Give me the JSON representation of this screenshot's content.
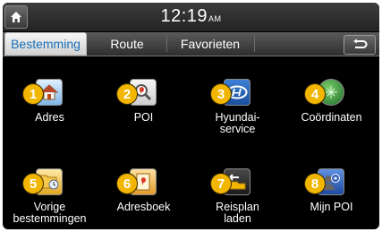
{
  "status_bar": {
    "time": "12:19",
    "ampm": "AM"
  },
  "tabs": [
    {
      "label": "Bestemming",
      "selected": true
    },
    {
      "label": "Route",
      "selected": false
    },
    {
      "label": "Favorieten",
      "selected": false
    }
  ],
  "icons": {
    "home": "home-icon",
    "back": "back-arrow-icon"
  },
  "menu": [
    {
      "number": "1",
      "label": "Adres",
      "icon": "house-icon"
    },
    {
      "number": "2",
      "label": "POI",
      "icon": "poi-search-icon"
    },
    {
      "number": "3",
      "label": "Hyundai-\nservice",
      "icon": "hyundai-logo-icon"
    },
    {
      "number": "4",
      "label": "Coördinaten",
      "icon": "globe-icon"
    },
    {
      "number": "5",
      "label": "Vorige\nbestemmingen",
      "icon": "folder-clock-icon"
    },
    {
      "number": "6",
      "label": "Adresboek",
      "icon": "address-book-icon"
    },
    {
      "number": "7",
      "label": "Reisplan\nladen",
      "icon": "route-plan-icon"
    },
    {
      "number": "8",
      "label": "Mijn POI",
      "icon": "my-poi-icon"
    }
  ],
  "colors": {
    "badge": "#f2b600",
    "active_tab_text": "#1a6fb8"
  }
}
